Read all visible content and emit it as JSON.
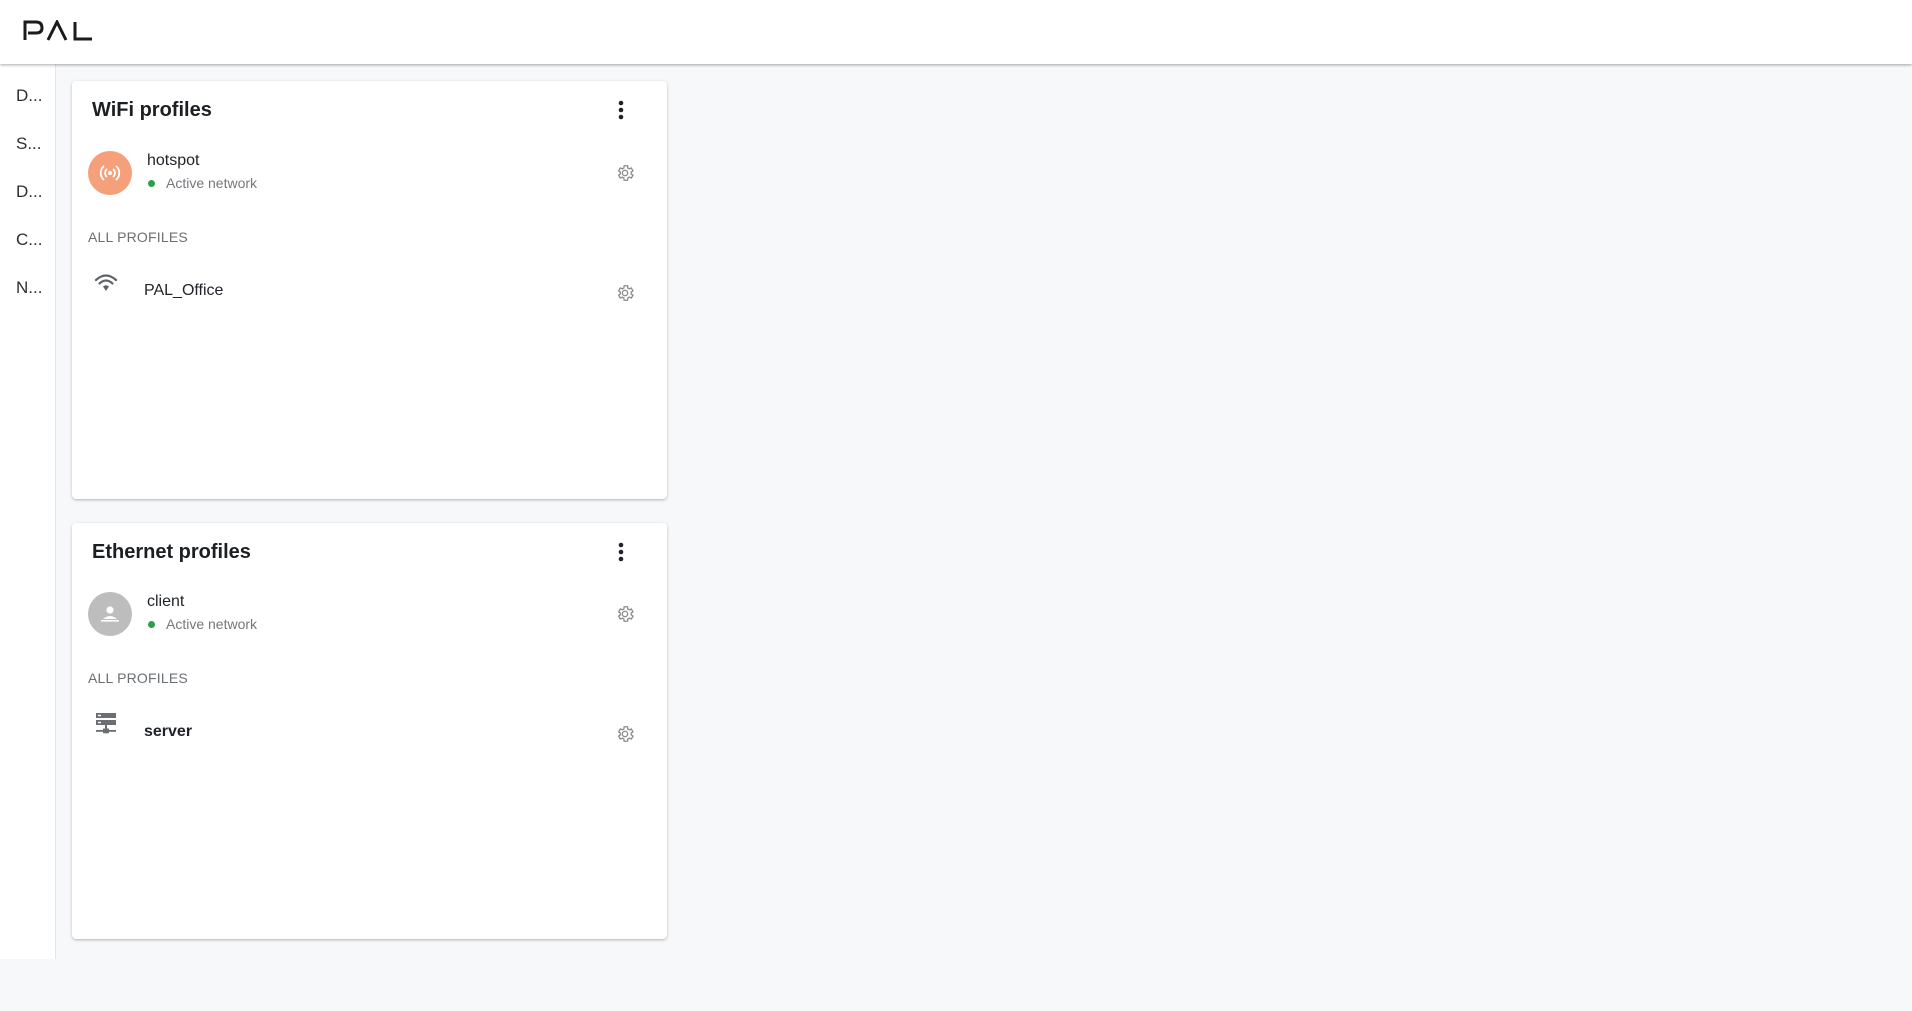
{
  "app": {
    "logo_text": "PAL"
  },
  "sidebar": {
    "items": [
      {
        "label": "D..."
      },
      {
        "label": "S..."
      },
      {
        "label": "D..."
      },
      {
        "label": "C..."
      },
      {
        "label": "N..."
      }
    ]
  },
  "wifi": {
    "title": "WiFi profiles",
    "active": {
      "name": "hotspot",
      "status": "Active network",
      "avatar_color": "#f5a07a",
      "icon": "hotspot-icon"
    },
    "section_label": "ALL PROFILES",
    "profiles": [
      {
        "name": "PAL_Office",
        "icon": "wifi-icon"
      }
    ]
  },
  "ethernet": {
    "title": "Ethernet profiles",
    "active": {
      "name": "client",
      "status": "Active network",
      "avatar_color": "#bdbdbd",
      "icon": "ethernet-client-icon"
    },
    "section_label": "ALL PROFILES",
    "profiles": [
      {
        "name": "server",
        "icon": "server-icon"
      }
    ]
  },
  "colors": {
    "active_dot": "#2e9e4c",
    "icon_gray": "#8a8d91"
  }
}
